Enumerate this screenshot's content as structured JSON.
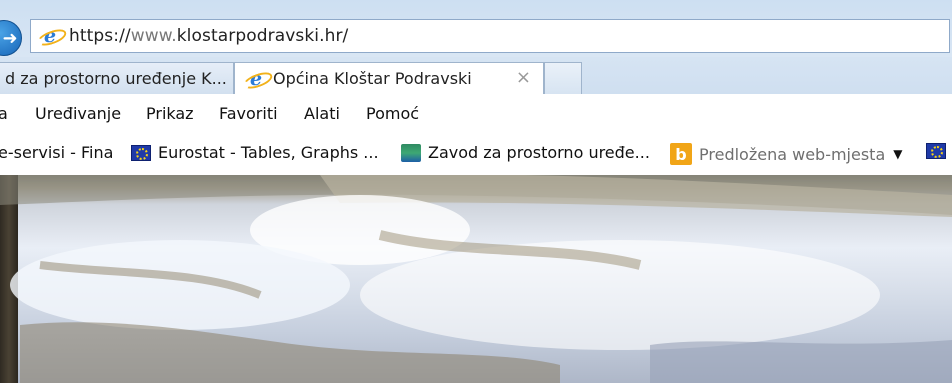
{
  "browser": {
    "address_bar": {
      "url_scheme": "https://",
      "url_muted": "www.",
      "url_host": "klostarpodravski.hr/"
    },
    "tabs": [
      {
        "label": "d za prostorno uređenje K...",
        "active": false
      },
      {
        "label": "Općina Kloštar Podravski",
        "active": true,
        "close_glyph": "×"
      }
    ],
    "menu": [
      "a",
      "Uređivanje",
      "Prikaz",
      "Favoriti",
      "Alati",
      "Pomoć"
    ],
    "favorites": [
      {
        "label": "e-servisi - Fina",
        "icon": "none"
      },
      {
        "label": "Eurostat - Tables, Graphs ...",
        "icon": "eu-flag-icon"
      },
      {
        "label": "Zavod za prostorno uređe...",
        "icon": "zavod-icon"
      },
      {
        "label": "Predložena web-mjesta",
        "icon": "bing-icon",
        "muted": true,
        "caret": "▼"
      }
    ]
  },
  "colors": {
    "accent": "#1765b8",
    "bing": "#f1a517",
    "eu_blue": "#1f3aa8"
  }
}
